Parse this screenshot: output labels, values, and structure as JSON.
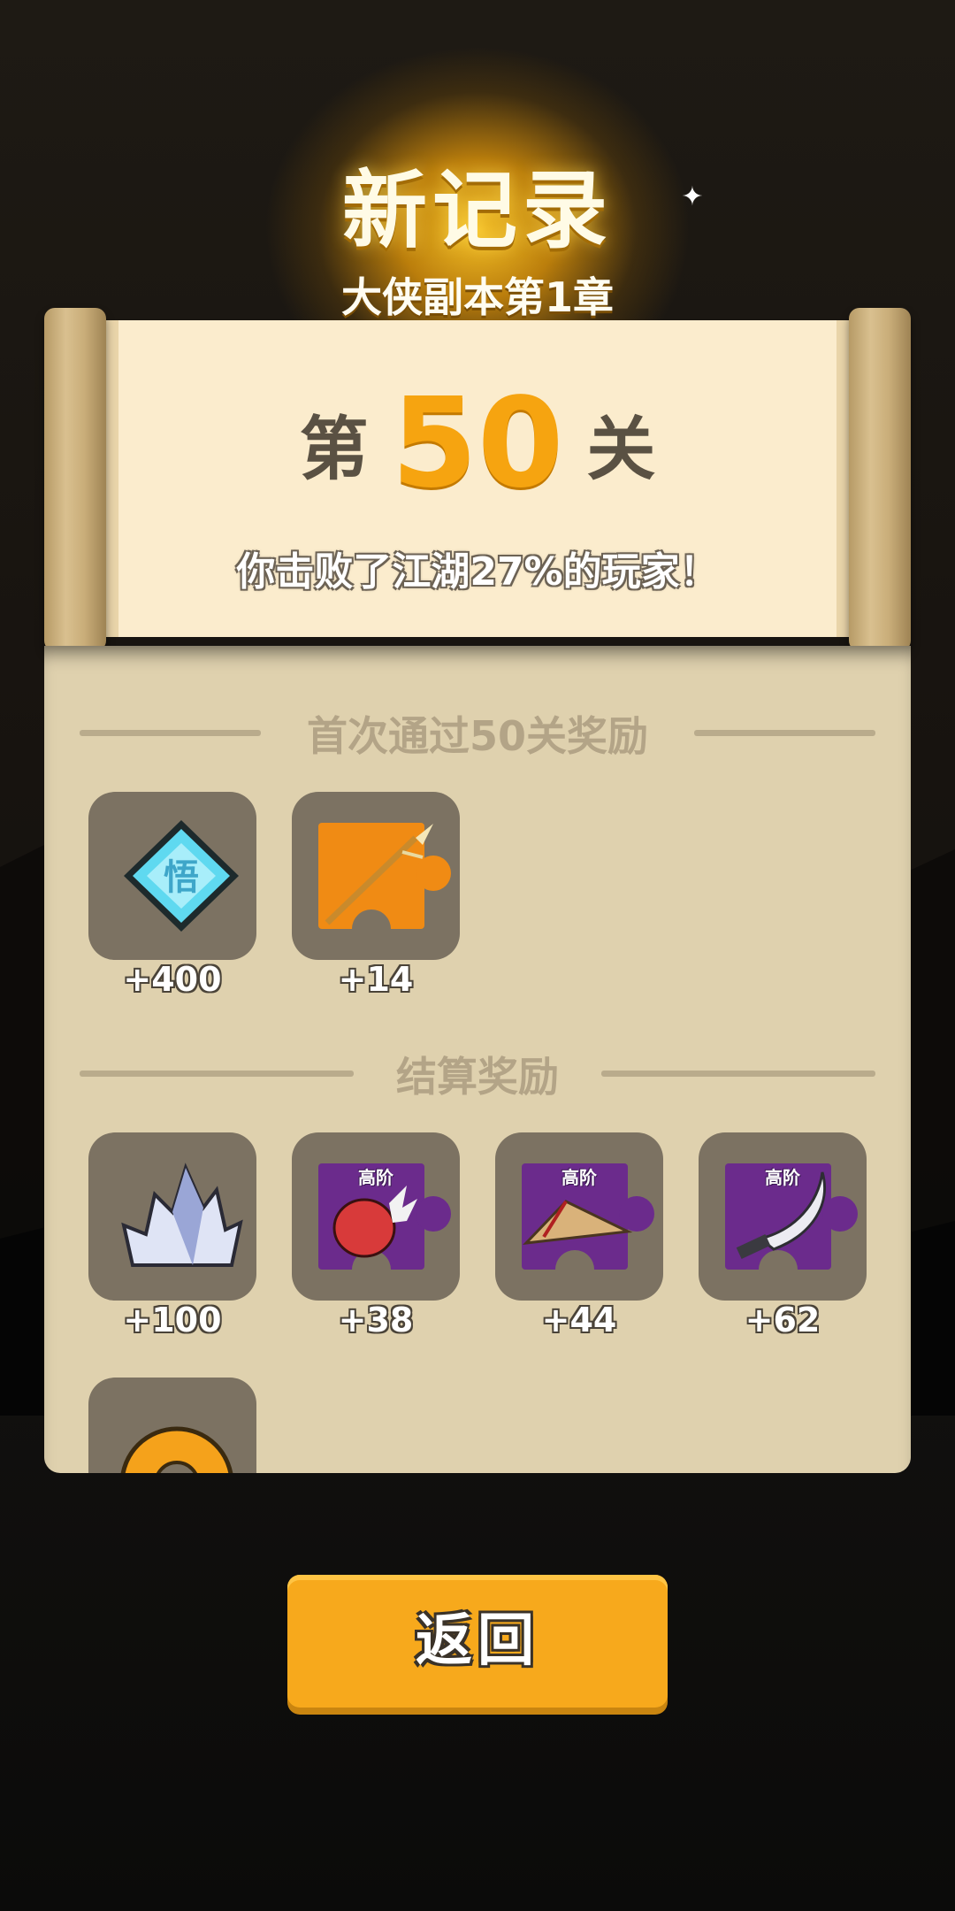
{
  "header": {
    "title": "新记录",
    "subtitle": "大侠副本第1章"
  },
  "scroll": {
    "stage_prefix": "第",
    "stage_number": "50",
    "stage_suffix": "关",
    "beat_text": "你击败了江湖27%的玩家！"
  },
  "first_clear": {
    "title": "首次通过50关奖励",
    "items": [
      {
        "icon": "wu-diamond-icon",
        "amount": "+400"
      },
      {
        "icon": "spear-fragment-icon",
        "amount": "+14"
      }
    ]
  },
  "settlement": {
    "title": "结算奖励",
    "items": [
      {
        "icon": "crystal-icon",
        "amount": "+100",
        "tag": ""
      },
      {
        "icon": "boxing-glove-fragment-icon",
        "amount": "+38",
        "tag": "高阶"
      },
      {
        "icon": "straw-hat-fragment-icon",
        "amount": "+44",
        "tag": "高阶"
      },
      {
        "icon": "saber-fragment-icon",
        "amount": "+62",
        "tag": "高阶"
      },
      {
        "icon": "gold-coin-icon",
        "amount": "",
        "tag": ""
      }
    ]
  },
  "colors": {
    "accent": "#f6a410",
    "panel": "#dfd1ae",
    "slot": "#7c7262",
    "button": "#f7a91c"
  },
  "button": {
    "label": "返回"
  }
}
